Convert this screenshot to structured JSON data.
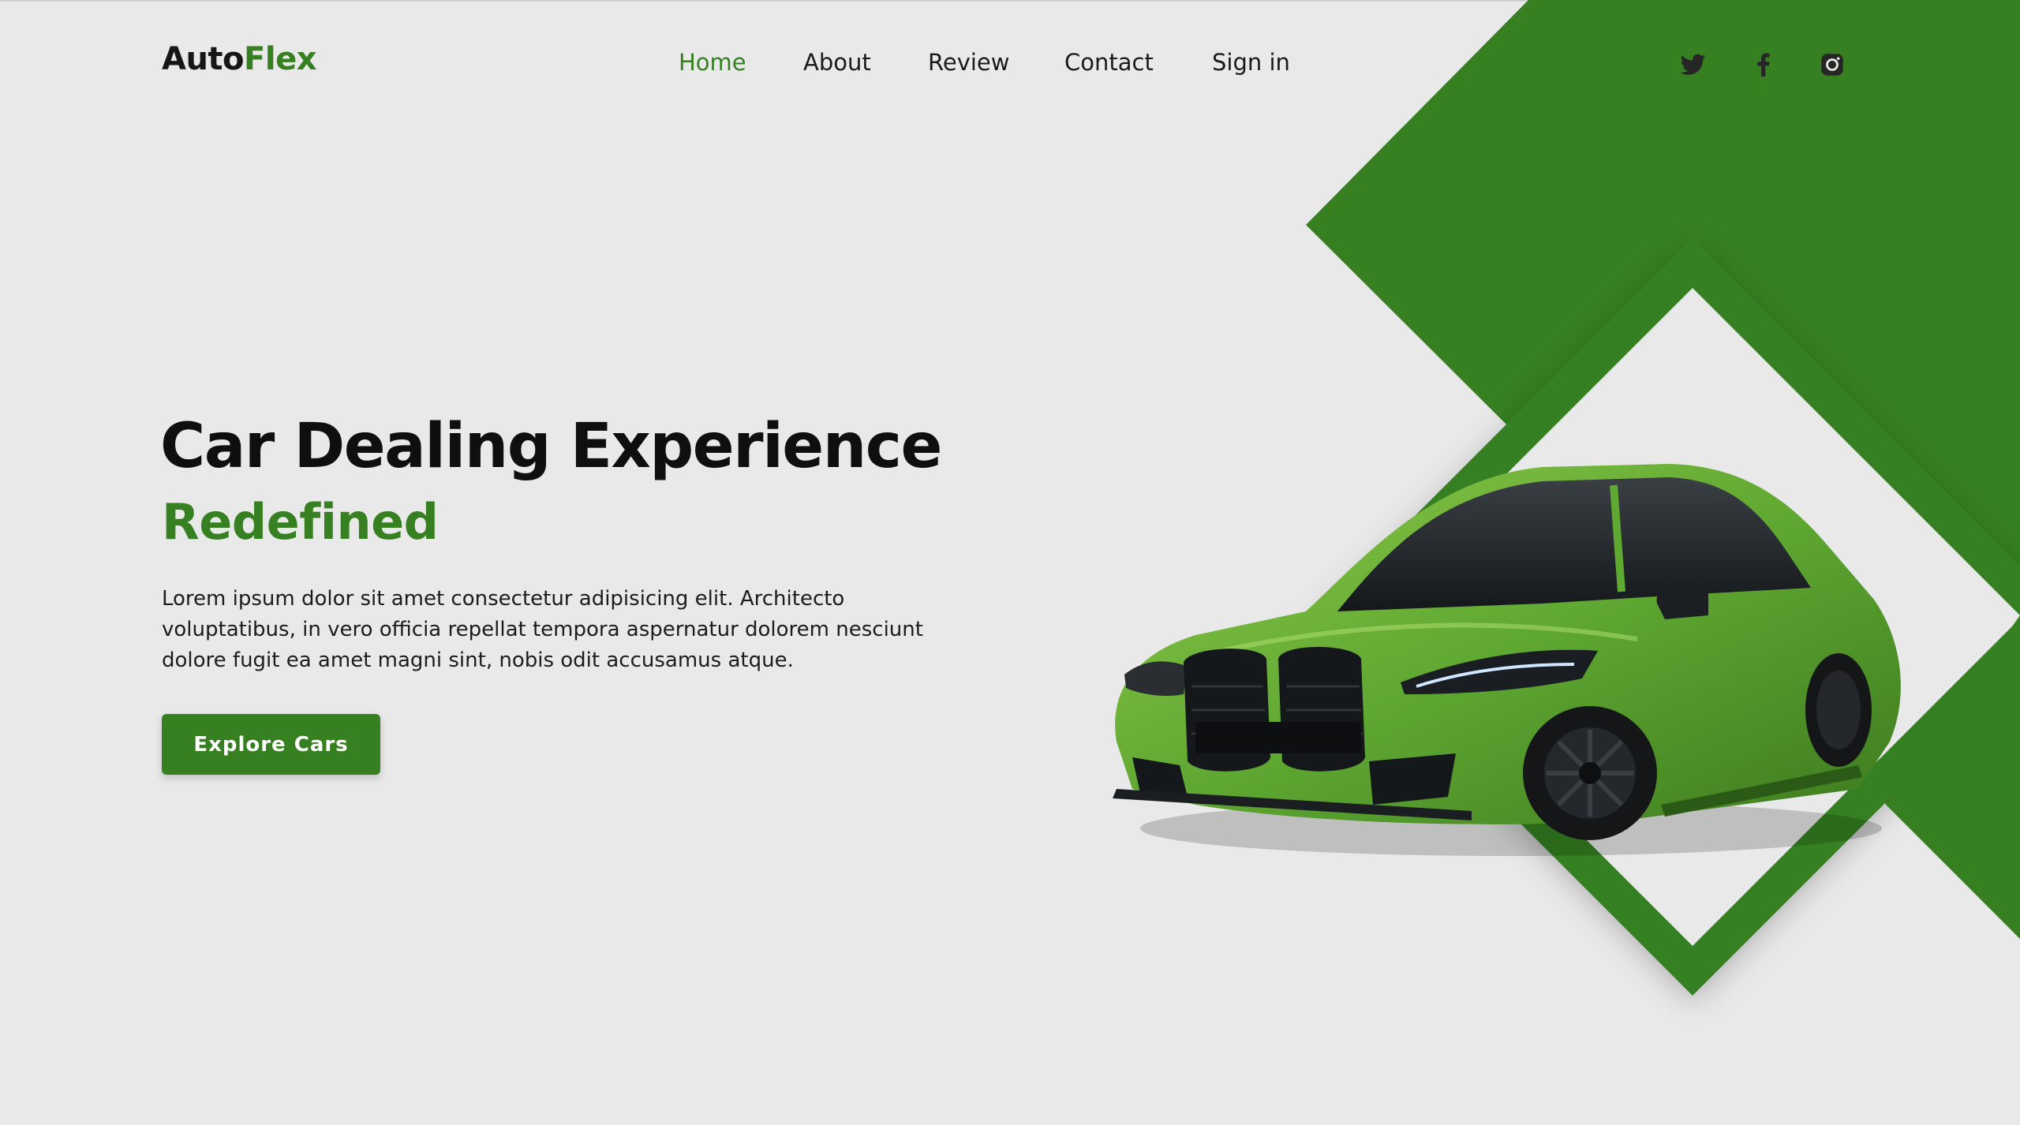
{
  "brand": {
    "name_part1": "Auto",
    "name_part2": "Flex",
    "accent_color": "#368021"
  },
  "nav": {
    "items": [
      {
        "label": "Home",
        "active": true
      },
      {
        "label": "About"
      },
      {
        "label": "Review"
      },
      {
        "label": "Contact"
      },
      {
        "label": "Sign in"
      }
    ]
  },
  "socials": [
    "twitter-icon",
    "facebook-icon",
    "instagram-icon"
  ],
  "hero": {
    "title": "Car Dealing Experience",
    "subtitle": "Redefined",
    "body": "Lorem ipsum dolor sit amet consectetur adipisicing elit. Architecto voluptatibus, in vero officia repellat tempora aspernatur dolorem nesciunt dolore fugit ea amet magni sint, nobis odit accusamus atque.",
    "cta_label": "Explore Cars"
  },
  "colors": {
    "background": "#e9e9e9",
    "primary_green": "#368021",
    "text_dark": "#0f0f0f"
  },
  "images": {
    "hero_car": "green sports sedan"
  }
}
